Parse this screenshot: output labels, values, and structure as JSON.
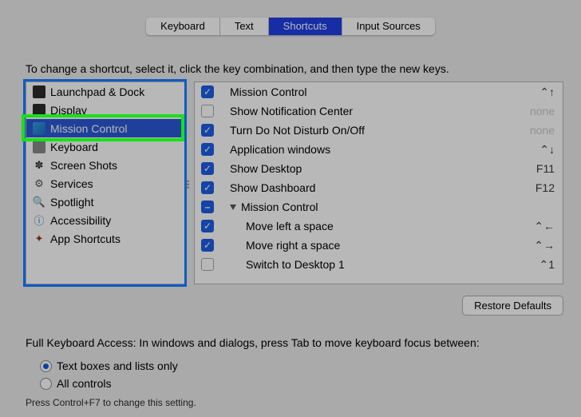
{
  "tabs": {
    "keyboard": "Keyboard",
    "text": "Text",
    "shortcuts": "Shortcuts",
    "input_sources": "Input Sources"
  },
  "instruction": "To change a shortcut, select it, click the key combination, and then type the new keys.",
  "sidebar": {
    "items": [
      {
        "label": "Launchpad & Dock"
      },
      {
        "label": "Display"
      },
      {
        "label": "Mission Control"
      },
      {
        "label": "Keyboard"
      },
      {
        "label": "Screen Shots"
      },
      {
        "label": "Services"
      },
      {
        "label": "Spotlight"
      },
      {
        "label": "Accessibility"
      },
      {
        "label": "App Shortcuts"
      }
    ],
    "selected_index": 2
  },
  "shortcuts": [
    {
      "checked": true,
      "label": "Mission Control",
      "keys": "⌃↑",
      "dim": false,
      "indent": 0
    },
    {
      "checked": false,
      "label": "Show Notification Center",
      "keys": "none",
      "dim": true,
      "indent": 0
    },
    {
      "checked": true,
      "label": "Turn Do Not Disturb On/Off",
      "keys": "none",
      "dim": true,
      "indent": 0
    },
    {
      "checked": true,
      "label": "Application windows",
      "keys": "⌃↓",
      "dim": false,
      "indent": 0
    },
    {
      "checked": true,
      "label": "Show Desktop",
      "keys": "F11",
      "dim": false,
      "indent": 0
    },
    {
      "checked": true,
      "label": "Show Dashboard",
      "keys": "F12",
      "dim": false,
      "indent": 0
    },
    {
      "checked": "mixed",
      "label": "Mission Control",
      "keys": "",
      "dim": false,
      "indent": 0,
      "group": true
    },
    {
      "checked": true,
      "label": "Move left a space",
      "keys": "⌃←",
      "dim": false,
      "indent": 1
    },
    {
      "checked": true,
      "label": "Move right a space",
      "keys": "⌃→",
      "dim": false,
      "indent": 1
    },
    {
      "checked": false,
      "label": "Switch to Desktop 1",
      "keys": "⌃1",
      "dim": false,
      "indent": 1
    }
  ],
  "restore_defaults": "Restore Defaults",
  "full_keyboard_access": "Full Keyboard Access: In windows and dialogs, press Tab to move keyboard focus between:",
  "radios": {
    "text_boxes": "Text boxes and lists only",
    "all_controls": "All controls",
    "selected": "text_boxes"
  },
  "footnote": "Press Control+F7 to change this setting."
}
